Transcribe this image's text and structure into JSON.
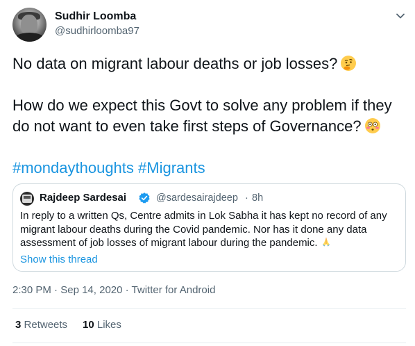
{
  "author": {
    "name": "Sudhir Loomba",
    "handle": "@sudhirloomba97"
  },
  "tweet": {
    "line1": "No data on migrant labour deaths or job losses?",
    "line2a": "How do we expect this Govt to solve any problem if they",
    "line2b": "do not want to even take first steps of Governance?",
    "hashtag1": "#mondaythoughts",
    "hashtag2": "#Migrants",
    "emoji1": "thinking-face-emoji",
    "emoji2": "flushed-face-emoji"
  },
  "quote": {
    "name": "Rajdeep Sardesai",
    "handle": "@sardesairajdeep",
    "separator": "·",
    "time": "8h",
    "line1": "In reply to a written Qs, Centre admits in Lok Sabha it has kept no record of any",
    "line2": "migrant labour deaths during the Covid pandemic. Nor has it done any data",
    "line3": "assessment of job losses of migrant labour during the pandemic.",
    "emoji": "folded-hands-emoji",
    "show_thread": "Show this thread"
  },
  "meta": {
    "time": "2:30 PM",
    "sep1": "·",
    "date": "Sep 14, 2020",
    "sep2": "·",
    "source": "Twitter for Android"
  },
  "stats": {
    "retweets_count": "3",
    "retweets_label": "Retweets",
    "likes_count": "10",
    "likes_label": "Likes"
  },
  "colors": {
    "link": "#1b95e0",
    "text": "#0f1419",
    "secondary": "#536471",
    "border": "#cfd9de"
  }
}
